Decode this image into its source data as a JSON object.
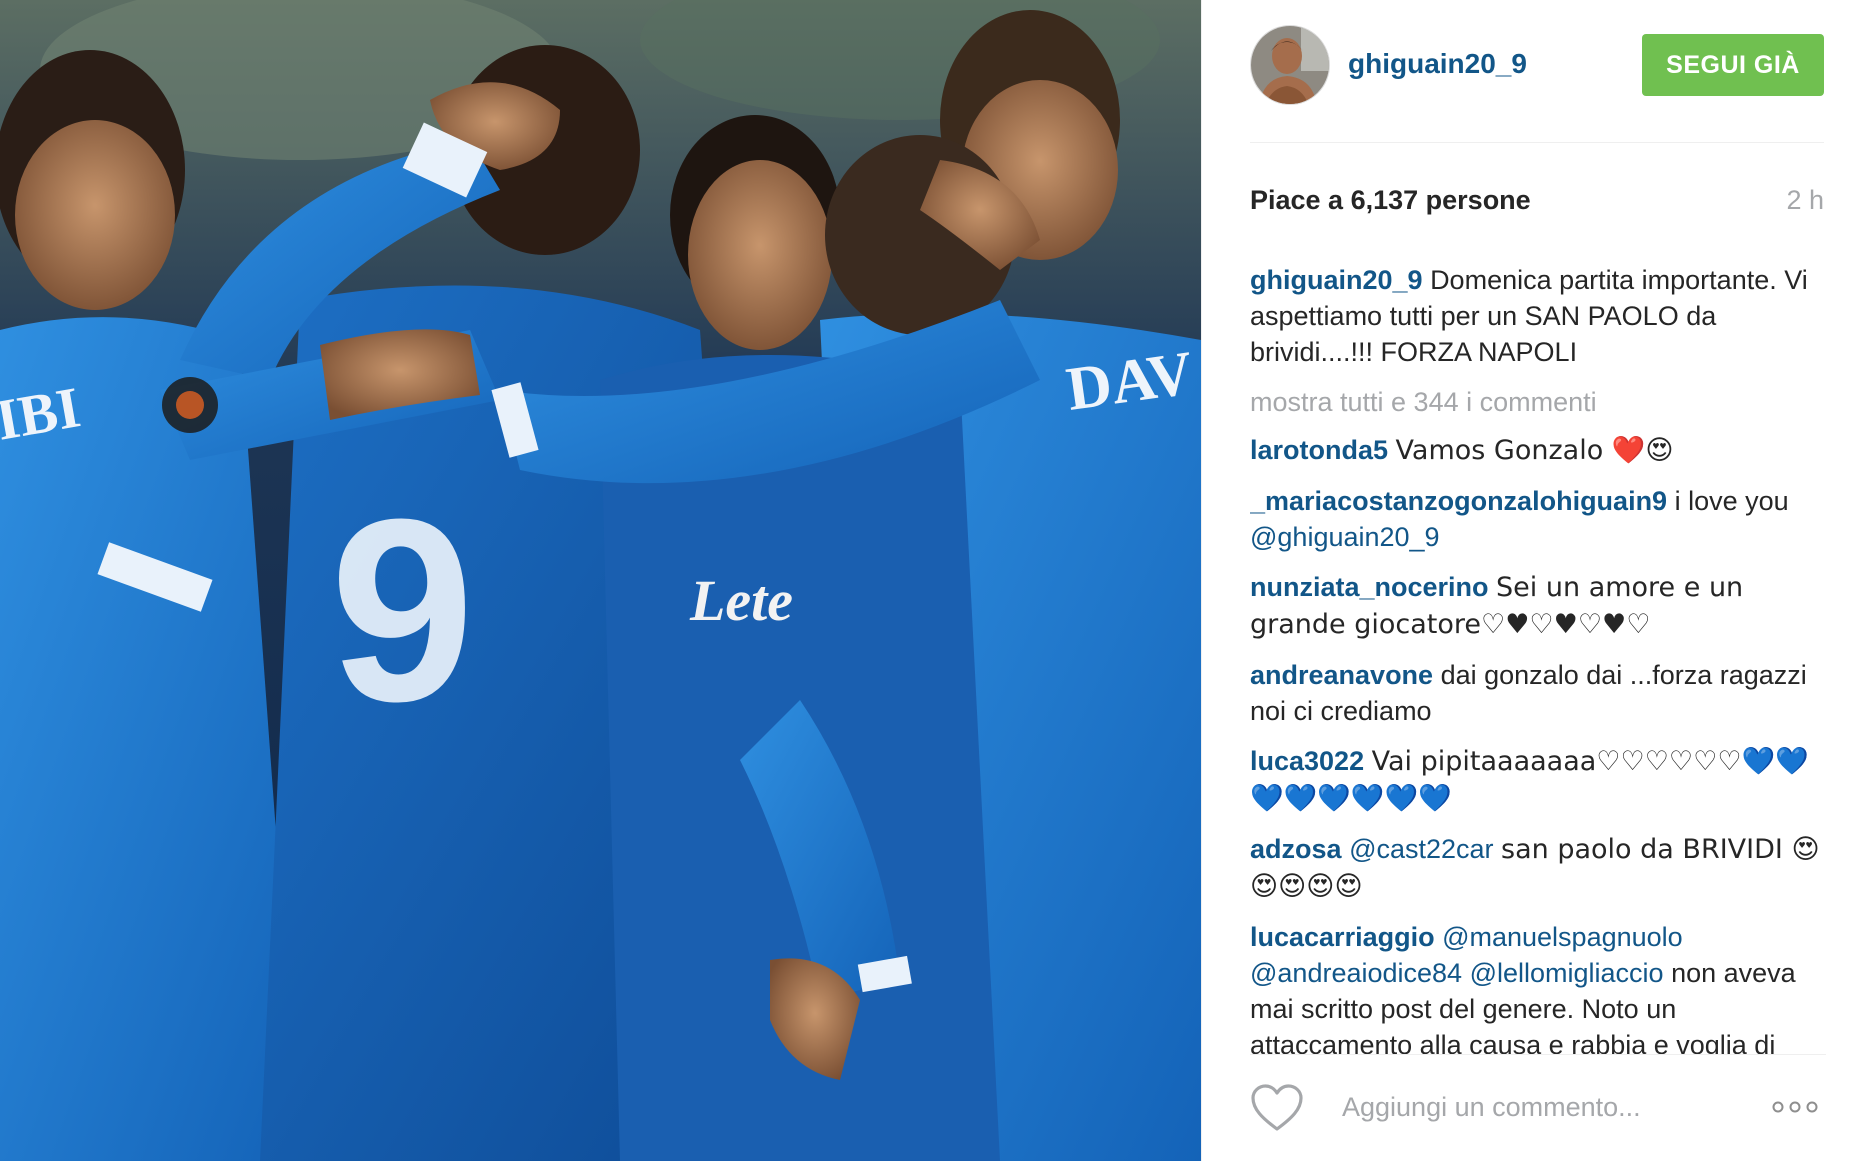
{
  "colors": {
    "link": "#125688",
    "follow_button_bg": "#70c050",
    "muted_text": "#a5a7aa",
    "body_text": "#262626"
  },
  "photo": {
    "jersey_name_1": "DAV",
    "jersey_name_2": "IBI",
    "jersey_number": "9",
    "sponsor": "Lete"
  },
  "header": {
    "username": "ghiguain20_9",
    "follow_label": "SEGUI GIÀ"
  },
  "meta": {
    "likes_prefix": "Piace a ",
    "likes_count": "6,137",
    "likes_suffix": " persone",
    "timestamp": "2 h"
  },
  "caption": {
    "author": "ghiguain20_9",
    "text": "Domenica partita importante. Vi aspettiamo tutti per un SAN PAOLO da brividi....!!! FORZA NAPOLI"
  },
  "load_more": "mostra tutti e 344 i commenti",
  "comments": [
    {
      "author": "larotonda5",
      "text": "Vamos Gonzalo ❤️😍"
    },
    {
      "author": "_mariacostanzogonzalohiguain9",
      "text": "i love you",
      "mention": "@ghiguain20_9"
    },
    {
      "author": "nunziata_nocerino",
      "text": "Sei un amore e un grande giocatore♡♥♡♥♡♥♡"
    },
    {
      "author": "andreanavone",
      "text": "dai gonzalo dai ...forza ragazzi noi ci crediamo"
    },
    {
      "author": "luca3022",
      "text": "Vai pipitaaaaaaa♡♡♡♡♡♡💙💙💙💙💙💙💙💙"
    },
    {
      "author": "adzosa",
      "mention": "@cast22car",
      "text": "san paolo da BRIVIDI 😍😍😍😍😍"
    },
    {
      "author": "lucacarriaggio",
      "mention": "@manuelspagnuolo",
      "mention2": "@andreaiodice84",
      "mention3": "@lellomigliaccio",
      "text": "non aveva mai scritto post del genere. Noto un attaccamento alla causa e rabbia e voglia di"
    }
  ],
  "footer": {
    "comment_placeholder": "Aggiungi un commento...",
    "like_icon": "heart-outline-icon",
    "more_icon": "ellipsis-icon"
  }
}
